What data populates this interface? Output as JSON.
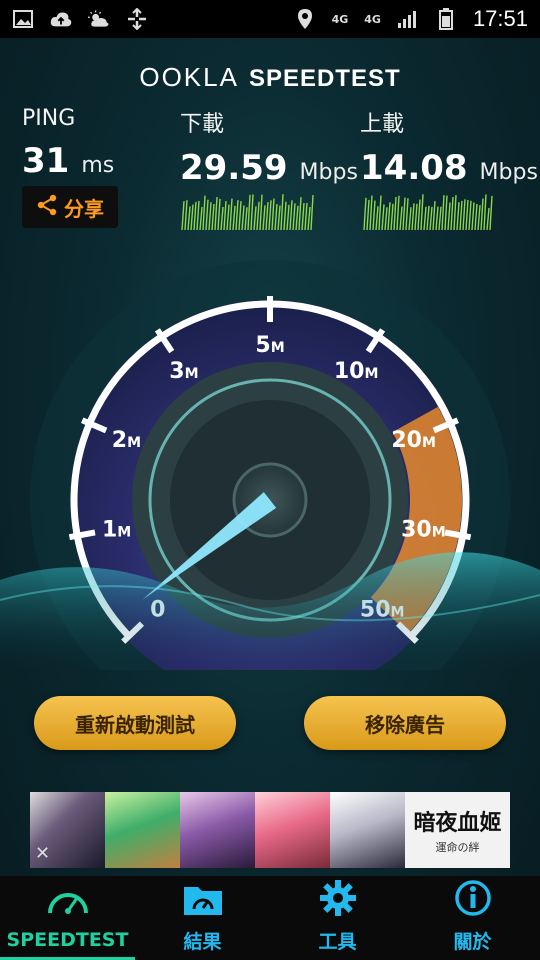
{
  "status_bar": {
    "net_label_1": "4G",
    "net_label_2": "4G",
    "time": "17:51"
  },
  "brand": {
    "ookla": "OOKLA",
    "speedtest": "SPEEDTEST"
  },
  "results": {
    "ping": {
      "label": "PING",
      "value": "31",
      "unit": "ms"
    },
    "download": {
      "label": "下載",
      "value": "29.59",
      "unit": "Mbps"
    },
    "upload": {
      "label": "上載",
      "value": "14.08",
      "unit": "Mbps"
    }
  },
  "share": {
    "label": "分享"
  },
  "gauge": {
    "ticks": [
      {
        "num": "0",
        "unit": ""
      },
      {
        "num": "1",
        "unit": "M"
      },
      {
        "num": "2",
        "unit": "M"
      },
      {
        "num": "3",
        "unit": "M"
      },
      {
        "num": "5",
        "unit": "M"
      },
      {
        "num": "10",
        "unit": "M"
      },
      {
        "num": "20",
        "unit": "M"
      },
      {
        "num": "30",
        "unit": "M"
      },
      {
        "num": "50",
        "unit": "M"
      }
    ],
    "accent_color": "#e88a2c",
    "needle_color": "#8fe8ff"
  },
  "actions": {
    "restart_label": "重新啟動測試",
    "remove_ads_label": "移除廣告"
  },
  "ads": {
    "close_label": "✕",
    "banner_text": "暗夜血姬",
    "banner_sub": "運命の絆"
  },
  "nav": {
    "speedtest": "SPEEDTEST",
    "results": "結果",
    "tools": "工具",
    "about": "關於"
  }
}
